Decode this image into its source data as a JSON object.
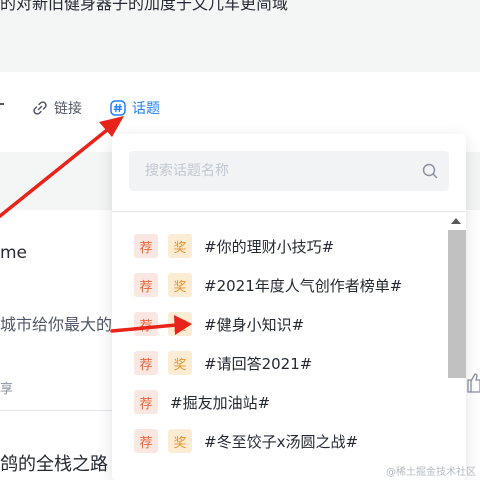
{
  "top": {
    "text": "的对新旧健身器子的加度于文儿车更简域"
  },
  "toolbar": {
    "link_label": "链接",
    "topic_label": "话题"
  },
  "feed": {
    "line1": "me",
    "line2": "城市给你最大的",
    "line3": "享",
    "line4": "鸽的全栈之路"
  },
  "panel": {
    "search_placeholder": "搜索话题名称",
    "badges": {
      "rec": "荐",
      "award": "奖"
    },
    "items": [
      {
        "text": "#你的理财小技巧#",
        "award": true
      },
      {
        "text": "#2021年度人气创作者榜单#",
        "award": true
      },
      {
        "text": "#健身小知识#",
        "award": true
      },
      {
        "text": "#请回答2021#",
        "award": true
      },
      {
        "text": "#掘友加油站#",
        "award": false
      },
      {
        "text": "#冬至饺子x汤圆之战#",
        "award": true
      }
    ]
  },
  "watermark": "@稀土掘金技术社区",
  "colors": {
    "accent": "#1e80ff",
    "arrow": "#e8231a",
    "rec_badge_bg": "#fbe7e1",
    "rec_badge_fg": "#e8663c",
    "award_badge_bg": "#fdecd4",
    "award_badge_fg": "#e5932b"
  },
  "icons": {
    "link": "link-icon",
    "topic": "hash-icon",
    "search": "search-icon"
  }
}
